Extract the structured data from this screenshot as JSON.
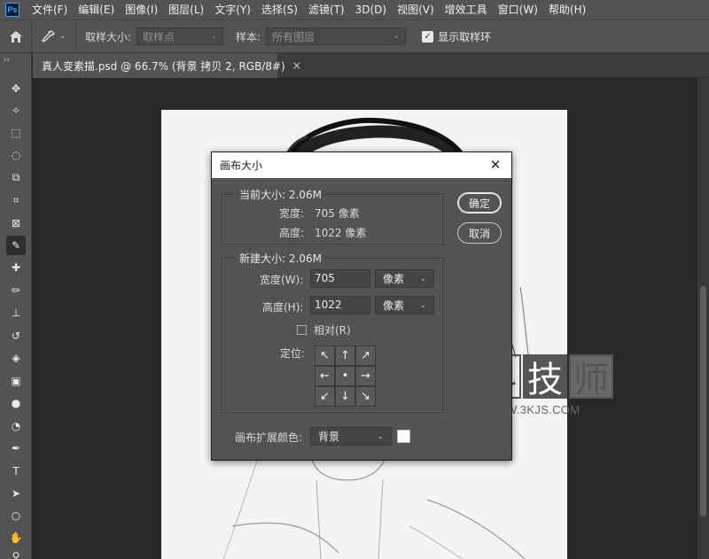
{
  "app": {
    "logo_text": "Ps",
    "menu": [
      "文件(F)",
      "编辑(E)",
      "图像(I)",
      "图层(L)",
      "文字(Y)",
      "选择(S)",
      "滤镜(T)",
      "3D(D)",
      "视图(V)",
      "增效工具",
      "窗口(W)",
      "帮助(H)"
    ]
  },
  "options": {
    "sample_size_label": "取样大小:",
    "sample_size_value": "取样点",
    "sample_label": "样本:",
    "sample_value": "所有图层",
    "show_ring_label": "显示取样环",
    "show_ring_checked": true
  },
  "document": {
    "tab_title": "真人变素描.psd @ 66.7% (背景 拷贝 2, RGB/8#)",
    "close_glyph": "×"
  },
  "tools": [
    {
      "name": "move-tool",
      "glyph": "✥"
    },
    {
      "name": "magic-wand-tool",
      "glyph": "✧"
    },
    {
      "name": "marquee-tool",
      "glyph": "⬚"
    },
    {
      "name": "lasso-tool",
      "glyph": "◌"
    },
    {
      "name": "object-select-tool",
      "glyph": "⧉"
    },
    {
      "name": "crop-tool",
      "glyph": "⌗"
    },
    {
      "name": "frame-tool",
      "glyph": "⊠"
    },
    {
      "name": "eyedropper-tool",
      "glyph": "✎"
    },
    {
      "name": "healing-brush-tool",
      "glyph": "✚"
    },
    {
      "name": "brush-tool",
      "glyph": "✏"
    },
    {
      "name": "clone-stamp-tool",
      "glyph": "⊥"
    },
    {
      "name": "history-brush-tool",
      "glyph": "↺"
    },
    {
      "name": "eraser-tool",
      "glyph": "◈"
    },
    {
      "name": "gradient-tool",
      "glyph": "▣"
    },
    {
      "name": "blur-tool",
      "glyph": "●"
    },
    {
      "name": "dodge-tool",
      "glyph": "◔"
    },
    {
      "name": "pen-tool",
      "glyph": "✒"
    },
    {
      "name": "type-tool",
      "glyph": "T"
    },
    {
      "name": "path-select-tool",
      "glyph": "➤"
    },
    {
      "name": "ellipse-tool",
      "glyph": "○"
    },
    {
      "name": "hand-tool",
      "glyph": "✋"
    },
    {
      "name": "zoom-tool",
      "glyph": "⚲"
    }
  ],
  "dialog": {
    "title": "画布大小",
    "close_glyph": "✕",
    "current_size": {
      "label": "当前大小: 2.06M",
      "width_label": "宽度:",
      "width_value": "705 像素",
      "height_label": "高度:",
      "height_value": "1022 像素"
    },
    "new_size": {
      "label": "新建大小: 2.06M",
      "width_label": "宽度(W):",
      "width_value": "705",
      "width_unit": "像素",
      "height_label": "高度(H):",
      "height_value": "1022",
      "height_unit": "像素",
      "relative_label": "相对(R)",
      "relative_checked": false,
      "anchor_label": "定位:",
      "anchor_glyphs": [
        "↖",
        "↑",
        "↗",
        "←",
        "•",
        "→",
        "↙",
        "↓",
        "↘"
      ]
    },
    "extension_color_label": "画布扩展颜色:",
    "extension_color_value": "背景",
    "extension_color_swatch": "#ffffff",
    "ok_label": "确定",
    "cancel_label": "取消"
  },
  "watermark": {
    "chars": [
      "科",
      "技",
      "师"
    ],
    "url": "WWW.3KJS.COM"
  }
}
